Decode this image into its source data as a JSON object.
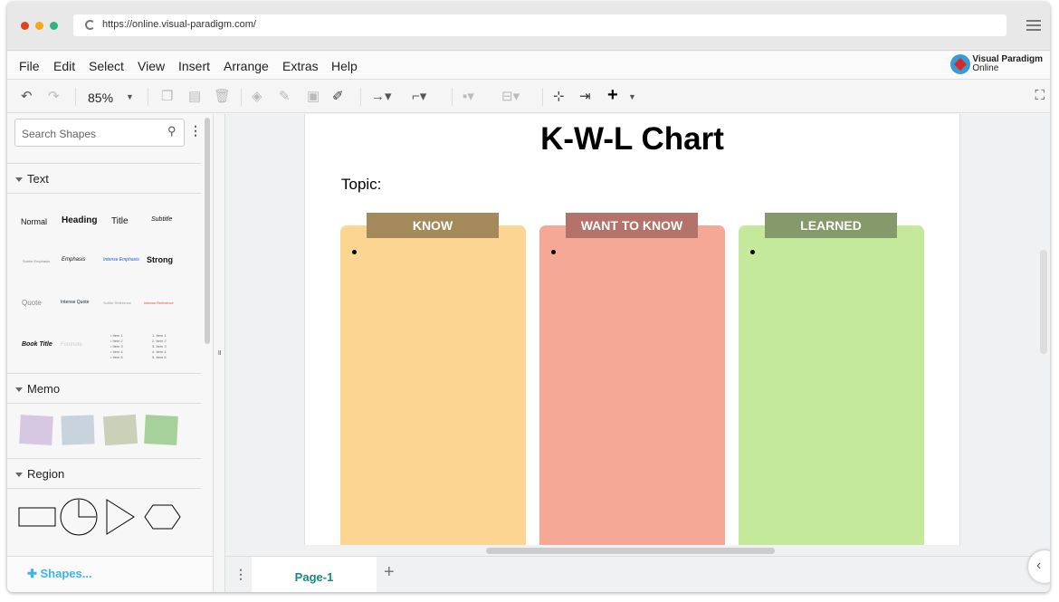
{
  "browser": {
    "url": "https://online.visual-paradigm.com/"
  },
  "menu": [
    "File",
    "Edit",
    "Select",
    "View",
    "Insert",
    "Arrange",
    "Extras",
    "Help"
  ],
  "logo": {
    "line1": "Visual Paradigm",
    "line2": "Online"
  },
  "toolbar": {
    "zoom": "85%"
  },
  "sidebar": {
    "search_placeholder": "Search Shapes",
    "sections": {
      "text": "Text",
      "memo": "Memo",
      "region": "Region"
    },
    "text_samples": [
      "Normal",
      "Heading",
      "Title",
      "Subtitle",
      "Subtle Emphasis",
      "Emphasis",
      "Intense Emphasis",
      "Strong",
      "Quote",
      "Intense Quote",
      "Subtle Reference",
      "Intense Reference",
      "Book Title",
      "Footnote"
    ],
    "bullet_list": "• Item 1\n• Item 2\n• Item 3\n• Item 4\n• Item 5",
    "numbered_list": "1. Item 1\n2. Item 2\n3. Item 3\n4. Item 4\n5. Item 5",
    "shapes_button": "Shapes..."
  },
  "document": {
    "title": "K-W-L Chart",
    "topic_label": "Topic:",
    "columns": [
      {
        "label": "KNOW",
        "body_color": "#fcd592",
        "header_color": "#a48a5a"
      },
      {
        "label": "WANT TO KNOW",
        "body_color": "#f6a896",
        "header_color": "#b3736a"
      },
      {
        "label": "LEARNED",
        "body_color": "#c5e99a",
        "header_color": "#86996a"
      }
    ]
  },
  "pages": {
    "tabs": [
      "Page-1"
    ]
  }
}
